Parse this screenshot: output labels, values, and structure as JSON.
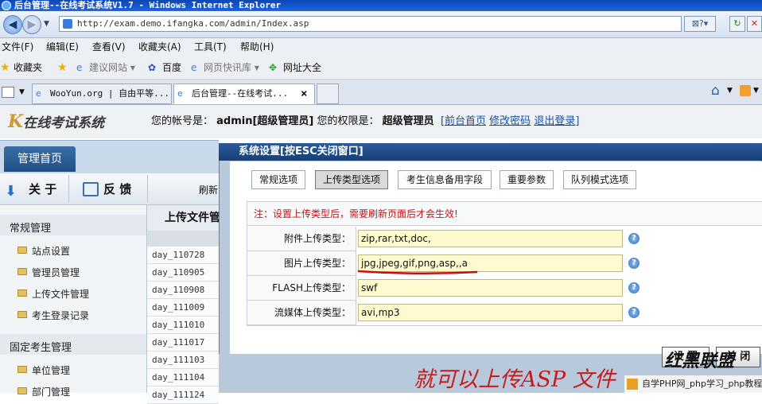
{
  "window": {
    "title": "后台管理--在线考试系统V1.7 - Windows Internet Explorer"
  },
  "browser": {
    "address": "http://exam.demo.ifangka.com/admin/Index.asp",
    "menu": [
      "文件(F)",
      "编辑(E)",
      "查看(V)",
      "收藏夹(A)",
      "工具(T)",
      "帮助(H)"
    ],
    "favorites": {
      "label": "收藏夹",
      "items": [
        "建议网站 ▾",
        "百度",
        "网页快讯库 ▾",
        "网址大全"
      ]
    },
    "tabs": [
      "WooYun.org | 自由平等...",
      "后台管理--在线考试..."
    ],
    "tab_close": "×"
  },
  "app": {
    "logo_k": "K",
    "logo_text": "在线考试系统",
    "account_label": "您的帐号是：",
    "account_value": "admin[超级管理员]",
    "role_label": "您的权限是：",
    "role_value": "超级管理员",
    "links": [
      "[前台首页",
      "修改密码",
      "退出登录]"
    ],
    "home_tab": "管理首页",
    "toolbar": {
      "about": "关 于",
      "feedback": "反 馈",
      "refresh": "刷新"
    },
    "sidebar": {
      "section1": "常规管理",
      "items1": [
        "站点设置",
        "管理员管理",
        "上传文件管理",
        "考生登录记录"
      ],
      "section2": "固定考生管理",
      "items2": [
        "单位管理",
        "部门管理"
      ]
    },
    "list": {
      "header": "上传文件管",
      "rows": [
        "day_110728",
        "day_110905",
        "day_110908",
        "day_111009",
        "day_111010",
        "day_111017",
        "day_111103",
        "day_111104",
        "day_111124"
      ]
    }
  },
  "modal": {
    "title": "系统设置[按ESC关闭窗口]",
    "tabs": [
      "常规选项",
      "上传类型选项",
      "考生信息备用字段",
      "重要参数",
      "队列模式选项"
    ],
    "active_tab": "上传类型选项",
    "note": "注：设置上传类型后，需要刷新页面后才会生效!",
    "fields": [
      {
        "label": "附件上传类型：",
        "value": "zip,rar,txt,doc,"
      },
      {
        "label": "图片上传类型：",
        "value": "jpg,jpeg,gif,png,asp,,a"
      },
      {
        "label": "FLASH上传类型：",
        "value": "swf"
      },
      {
        "label": "流媒体上传类型：",
        "value": "avi,mp3"
      }
    ],
    "help_glyph": "?",
    "buttons": {
      "set": "设 置",
      "close": "关 闭"
    }
  },
  "overlay": {
    "annotation": "就可以上传ASP 文件",
    "stamp": "红黑联盟",
    "watermark": "自学PHP网_php学习_php教程"
  },
  "colors": {
    "accent": "#1f4f86",
    "note_red": "#d01010",
    "input_bg": "#fffbcf"
  }
}
